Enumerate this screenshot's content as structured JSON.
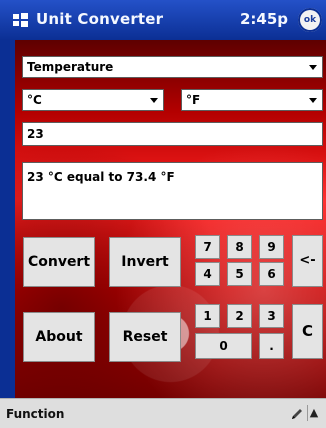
{
  "titlebar": {
    "start_icon": "windows-flag-icon",
    "title": "Unit Converter",
    "time": "2:45p",
    "ok": "ok"
  },
  "selects": {
    "category": "Temperature",
    "from_unit": "°C",
    "to_unit": "°F"
  },
  "input": {
    "value": "23"
  },
  "result": {
    "text": "23 °C equal to 73.4 °F"
  },
  "buttons": {
    "convert": "Convert",
    "invert": "Invert",
    "about": "About",
    "reset": "Reset"
  },
  "keypad": {
    "keys": [
      "7",
      "8",
      "9",
      "4",
      "5",
      "6",
      "1",
      "2",
      "3",
      "0",
      "."
    ],
    "backspace": "<-",
    "clear": "C"
  },
  "bottom": {
    "menu": "Function",
    "pen_icon": "pen-icon",
    "menu_arrow_icon": "triangle-up-icon"
  }
}
